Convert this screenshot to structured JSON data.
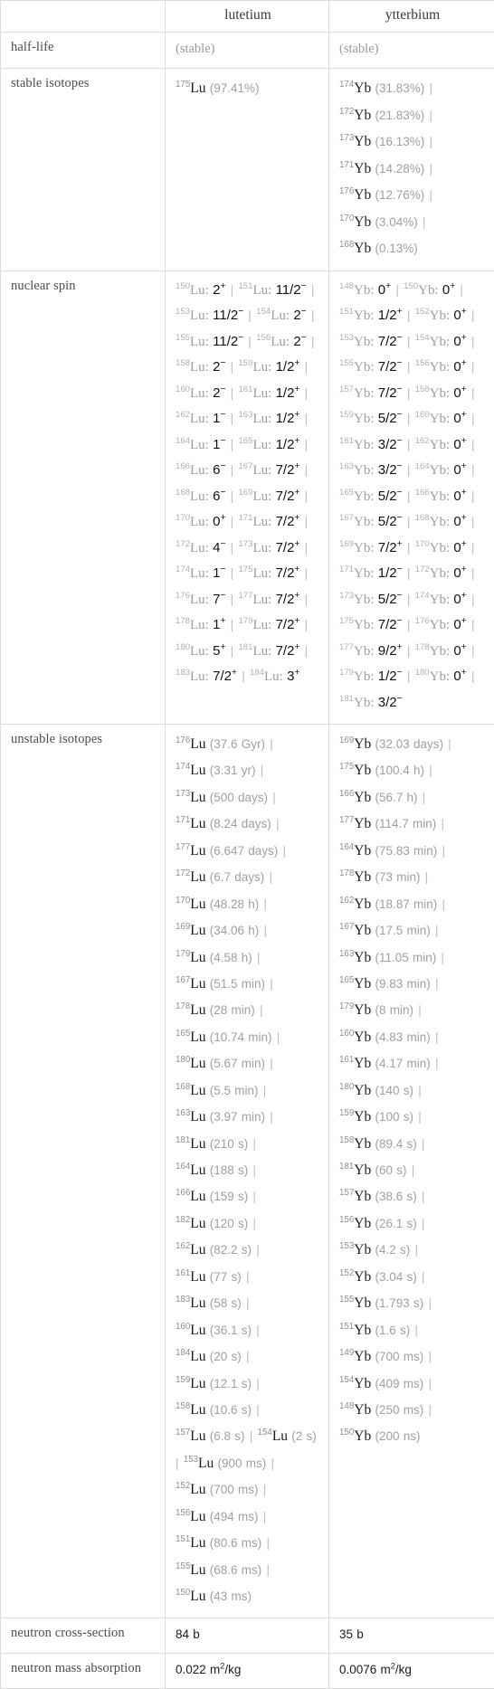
{
  "table": {
    "header": {
      "blank": "",
      "col1": "lutetium",
      "col2": "ytterbium"
    },
    "rows": [
      {
        "label": "half-life",
        "lutetium": {
          "kind": "muted_text",
          "text": "(stable)"
        },
        "ytterbium": {
          "kind": "muted_text",
          "text": "(stable)"
        }
      },
      {
        "label": "stable isotopes",
        "lutetium": {
          "kind": "isotope_list",
          "items": [
            {
              "mass": "175",
              "symbol": "Lu",
              "value": "(97.41%)"
            }
          ]
        },
        "ytterbium": {
          "kind": "isotope_list",
          "items": [
            {
              "mass": "174",
              "symbol": "Yb",
              "value": "(31.83%)"
            },
            {
              "mass": "172",
              "symbol": "Yb",
              "value": "(21.83%)"
            },
            {
              "mass": "173",
              "symbol": "Yb",
              "value": "(16.13%)"
            },
            {
              "mass": "171",
              "symbol": "Yb",
              "value": "(14.28%)"
            },
            {
              "mass": "176",
              "symbol": "Yb",
              "value": "(12.76%)"
            },
            {
              "mass": "170",
              "symbol": "Yb",
              "value": "(3.04%)"
            },
            {
              "mass": "168",
              "symbol": "Yb",
              "value": "(0.13%)"
            }
          ]
        }
      },
      {
        "label": "nuclear spin",
        "lutetium": {
          "kind": "spin_list",
          "items": [
            {
              "mass": "150",
              "symbol": "Lu",
              "spin": "2",
              "sign": "+"
            },
            {
              "mass": "151",
              "symbol": "Lu",
              "spin": "11/2",
              "sign": "−"
            },
            {
              "mass": "153",
              "symbol": "Lu",
              "spin": "11/2",
              "sign": "−"
            },
            {
              "mass": "154",
              "symbol": "Lu",
              "spin": "2",
              "sign": "−"
            },
            {
              "mass": "155",
              "symbol": "Lu",
              "spin": "11/2",
              "sign": "−"
            },
            {
              "mass": "156",
              "symbol": "Lu",
              "spin": "2",
              "sign": "−"
            },
            {
              "mass": "158",
              "symbol": "Lu",
              "spin": "2",
              "sign": "−"
            },
            {
              "mass": "159",
              "symbol": "Lu",
              "spin": "1/2",
              "sign": "+"
            },
            {
              "mass": "160",
              "symbol": "Lu",
              "spin": "2",
              "sign": "−"
            },
            {
              "mass": "161",
              "symbol": "Lu",
              "spin": "1/2",
              "sign": "+"
            },
            {
              "mass": "162",
              "symbol": "Lu",
              "spin": "1",
              "sign": "−"
            },
            {
              "mass": "163",
              "symbol": "Lu",
              "spin": "1/2",
              "sign": "+"
            },
            {
              "mass": "164",
              "symbol": "Lu",
              "spin": "1",
              "sign": "−"
            },
            {
              "mass": "165",
              "symbol": "Lu",
              "spin": "1/2",
              "sign": "+"
            },
            {
              "mass": "166",
              "symbol": "Lu",
              "spin": "6",
              "sign": "−"
            },
            {
              "mass": "167",
              "symbol": "Lu",
              "spin": "7/2",
              "sign": "+"
            },
            {
              "mass": "168",
              "symbol": "Lu",
              "spin": "6",
              "sign": "−"
            },
            {
              "mass": "169",
              "symbol": "Lu",
              "spin": "7/2",
              "sign": "+"
            },
            {
              "mass": "170",
              "symbol": "Lu",
              "spin": "0",
              "sign": "+"
            },
            {
              "mass": "171",
              "symbol": "Lu",
              "spin": "7/2",
              "sign": "+"
            },
            {
              "mass": "172",
              "symbol": "Lu",
              "spin": "4",
              "sign": "−"
            },
            {
              "mass": "173",
              "symbol": "Lu",
              "spin": "7/2",
              "sign": "+"
            },
            {
              "mass": "174",
              "symbol": "Lu",
              "spin": "1",
              "sign": "−"
            },
            {
              "mass": "175",
              "symbol": "Lu",
              "spin": "7/2",
              "sign": "+"
            },
            {
              "mass": "176",
              "symbol": "Lu",
              "spin": "7",
              "sign": "−"
            },
            {
              "mass": "177",
              "symbol": "Lu",
              "spin": "7/2",
              "sign": "+"
            },
            {
              "mass": "178",
              "symbol": "Lu",
              "spin": "1",
              "sign": "+"
            },
            {
              "mass": "179",
              "symbol": "Lu",
              "spin": "7/2",
              "sign": "+"
            },
            {
              "mass": "180",
              "symbol": "Lu",
              "spin": "5",
              "sign": "+"
            },
            {
              "mass": "181",
              "symbol": "Lu",
              "spin": "7/2",
              "sign": "+"
            },
            {
              "mass": "183",
              "symbol": "Lu",
              "spin": "7/2",
              "sign": "+"
            },
            {
              "mass": "184",
              "symbol": "Lu",
              "spin": "3",
              "sign": "+"
            }
          ]
        },
        "ytterbium": {
          "kind": "spin_list",
          "items": [
            {
              "mass": "148",
              "symbol": "Yb",
              "spin": "0",
              "sign": "+"
            },
            {
              "mass": "150",
              "symbol": "Yb",
              "spin": "0",
              "sign": "+"
            },
            {
              "mass": "151",
              "symbol": "Yb",
              "spin": "1/2",
              "sign": "+"
            },
            {
              "mass": "152",
              "symbol": "Yb",
              "spin": "0",
              "sign": "+"
            },
            {
              "mass": "153",
              "symbol": "Yb",
              "spin": "7/2",
              "sign": "−"
            },
            {
              "mass": "154",
              "symbol": "Yb",
              "spin": "0",
              "sign": "+"
            },
            {
              "mass": "155",
              "symbol": "Yb",
              "spin": "7/2",
              "sign": "−"
            },
            {
              "mass": "156",
              "symbol": "Yb",
              "spin": "0",
              "sign": "+"
            },
            {
              "mass": "157",
              "symbol": "Yb",
              "spin": "7/2",
              "sign": "−"
            },
            {
              "mass": "158",
              "symbol": "Yb",
              "spin": "0",
              "sign": "+"
            },
            {
              "mass": "159",
              "symbol": "Yb",
              "spin": "5/2",
              "sign": "−"
            },
            {
              "mass": "160",
              "symbol": "Yb",
              "spin": "0",
              "sign": "+"
            },
            {
              "mass": "161",
              "symbol": "Yb",
              "spin": "3/2",
              "sign": "−"
            },
            {
              "mass": "162",
              "symbol": "Yb",
              "spin": "0",
              "sign": "+"
            },
            {
              "mass": "163",
              "symbol": "Yb",
              "spin": "3/2",
              "sign": "−"
            },
            {
              "mass": "164",
              "symbol": "Yb",
              "spin": "0",
              "sign": "+"
            },
            {
              "mass": "165",
              "symbol": "Yb",
              "spin": "5/2",
              "sign": "−"
            },
            {
              "mass": "166",
              "symbol": "Yb",
              "spin": "0",
              "sign": "+"
            },
            {
              "mass": "167",
              "symbol": "Yb",
              "spin": "5/2",
              "sign": "−"
            },
            {
              "mass": "168",
              "symbol": "Yb",
              "spin": "0",
              "sign": "+"
            },
            {
              "mass": "169",
              "symbol": "Yb",
              "spin": "7/2",
              "sign": "+"
            },
            {
              "mass": "170",
              "symbol": "Yb",
              "spin": "0",
              "sign": "+"
            },
            {
              "mass": "171",
              "symbol": "Yb",
              "spin": "1/2",
              "sign": "−"
            },
            {
              "mass": "172",
              "symbol": "Yb",
              "spin": "0",
              "sign": "+"
            },
            {
              "mass": "173",
              "symbol": "Yb",
              "spin": "5/2",
              "sign": "−"
            },
            {
              "mass": "174",
              "symbol": "Yb",
              "spin": "0",
              "sign": "+"
            },
            {
              "mass": "175",
              "symbol": "Yb",
              "spin": "7/2",
              "sign": "−"
            },
            {
              "mass": "176",
              "symbol": "Yb",
              "spin": "0",
              "sign": "+"
            },
            {
              "mass": "177",
              "symbol": "Yb",
              "spin": "9/2",
              "sign": "+"
            },
            {
              "mass": "178",
              "symbol": "Yb",
              "spin": "0",
              "sign": "+"
            },
            {
              "mass": "179",
              "symbol": "Yb",
              "spin": "1/2",
              "sign": "−"
            },
            {
              "mass": "180",
              "symbol": "Yb",
              "spin": "0",
              "sign": "+"
            },
            {
              "mass": "181",
              "symbol": "Yb",
              "spin": "3/2",
              "sign": "−"
            }
          ]
        }
      },
      {
        "label": "unstable isotopes",
        "lutetium": {
          "kind": "isotope_list",
          "items": [
            {
              "mass": "176",
              "symbol": "Lu",
              "value": "(37.6 Gyr)"
            },
            {
              "mass": "174",
              "symbol": "Lu",
              "value": "(3.31 yr)"
            },
            {
              "mass": "173",
              "symbol": "Lu",
              "value": "(500 days)"
            },
            {
              "mass": "171",
              "symbol": "Lu",
              "value": "(8.24 days)"
            },
            {
              "mass": "177",
              "symbol": "Lu",
              "value": "(6.647 days)"
            },
            {
              "mass": "172",
              "symbol": "Lu",
              "value": "(6.7 days)"
            },
            {
              "mass": "170",
              "symbol": "Lu",
              "value": "(48.28 h)"
            },
            {
              "mass": "169",
              "symbol": "Lu",
              "value": "(34.06 h)"
            },
            {
              "mass": "179",
              "symbol": "Lu",
              "value": "(4.58 h)"
            },
            {
              "mass": "167",
              "symbol": "Lu",
              "value": "(51.5 min)"
            },
            {
              "mass": "178",
              "symbol": "Lu",
              "value": "(28 min)"
            },
            {
              "mass": "165",
              "symbol": "Lu",
              "value": "(10.74 min)"
            },
            {
              "mass": "180",
              "symbol": "Lu",
              "value": "(5.67 min)"
            },
            {
              "mass": "168",
              "symbol": "Lu",
              "value": "(5.5 min)"
            },
            {
              "mass": "163",
              "symbol": "Lu",
              "value": "(3.97 min)"
            },
            {
              "mass": "181",
              "symbol": "Lu",
              "value": "(210 s)"
            },
            {
              "mass": "164",
              "symbol": "Lu",
              "value": "(188 s)"
            },
            {
              "mass": "166",
              "symbol": "Lu",
              "value": "(159 s)"
            },
            {
              "mass": "182",
              "symbol": "Lu",
              "value": "(120 s)"
            },
            {
              "mass": "162",
              "symbol": "Lu",
              "value": "(82.2 s)"
            },
            {
              "mass": "161",
              "symbol": "Lu",
              "value": "(77 s)"
            },
            {
              "mass": "183",
              "symbol": "Lu",
              "value": "(58 s)"
            },
            {
              "mass": "160",
              "symbol": "Lu",
              "value": "(36.1 s)"
            },
            {
              "mass": "184",
              "symbol": "Lu",
              "value": "(20 s)"
            },
            {
              "mass": "159",
              "symbol": "Lu",
              "value": "(12.1 s)"
            },
            {
              "mass": "158",
              "symbol": "Lu",
              "value": "(10.6 s)"
            },
            {
              "mass": "157",
              "symbol": "Lu",
              "value": "(6.8 s)"
            },
            {
              "mass": "154",
              "symbol": "Lu",
              "value": "(2 s)"
            },
            {
              "mass": "153",
              "symbol": "Lu",
              "value": "(900 ms)"
            },
            {
              "mass": "152",
              "symbol": "Lu",
              "value": "(700 ms)"
            },
            {
              "mass": "156",
              "symbol": "Lu",
              "value": "(494 ms)"
            },
            {
              "mass": "151",
              "symbol": "Lu",
              "value": "(80.6 ms)"
            },
            {
              "mass": "155",
              "symbol": "Lu",
              "value": "(68.6 ms)"
            },
            {
              "mass": "150",
              "symbol": "Lu",
              "value": "(43 ms)"
            }
          ]
        },
        "ytterbium": {
          "kind": "isotope_list",
          "items": [
            {
              "mass": "169",
              "symbol": "Yb",
              "value": "(32.03 days)"
            },
            {
              "mass": "175",
              "symbol": "Yb",
              "value": "(100.4 h)"
            },
            {
              "mass": "166",
              "symbol": "Yb",
              "value": "(56.7 h)"
            },
            {
              "mass": "177",
              "symbol": "Yb",
              "value": "(114.7 min)"
            },
            {
              "mass": "164",
              "symbol": "Yb",
              "value": "(75.83 min)"
            },
            {
              "mass": "178",
              "symbol": "Yb",
              "value": "(73 min)"
            },
            {
              "mass": "162",
              "symbol": "Yb",
              "value": "(18.87 min)"
            },
            {
              "mass": "167",
              "symbol": "Yb",
              "value": "(17.5 min)"
            },
            {
              "mass": "163",
              "symbol": "Yb",
              "value": "(11.05 min)"
            },
            {
              "mass": "165",
              "symbol": "Yb",
              "value": "(9.83 min)"
            },
            {
              "mass": "179",
              "symbol": "Yb",
              "value": "(8 min)"
            },
            {
              "mass": "160",
              "symbol": "Yb",
              "value": "(4.83 min)"
            },
            {
              "mass": "161",
              "symbol": "Yb",
              "value": "(4.17 min)"
            },
            {
              "mass": "180",
              "symbol": "Yb",
              "value": "(140 s)"
            },
            {
              "mass": "159",
              "symbol": "Yb",
              "value": "(100 s)"
            },
            {
              "mass": "158",
              "symbol": "Yb",
              "value": "(89.4 s)"
            },
            {
              "mass": "181",
              "symbol": "Yb",
              "value": "(60 s)"
            },
            {
              "mass": "157",
              "symbol": "Yb",
              "value": "(38.6 s)"
            },
            {
              "mass": "156",
              "symbol": "Yb",
              "value": "(26.1 s)"
            },
            {
              "mass": "153",
              "symbol": "Yb",
              "value": "(4.2 s)"
            },
            {
              "mass": "152",
              "symbol": "Yb",
              "value": "(3.04 s)"
            },
            {
              "mass": "155",
              "symbol": "Yb",
              "value": "(1.793 s)"
            },
            {
              "mass": "151",
              "symbol": "Yb",
              "value": "(1.6 s)"
            },
            {
              "mass": "149",
              "symbol": "Yb",
              "value": "(700 ms)"
            },
            {
              "mass": "154",
              "symbol": "Yb",
              "value": "(409 ms)"
            },
            {
              "mass": "148",
              "symbol": "Yb",
              "value": "(250 ms)"
            },
            {
              "mass": "150",
              "symbol": "Yb",
              "value": "(200 ns)"
            }
          ]
        }
      },
      {
        "label": "neutron cross-section",
        "lutetium": {
          "kind": "plain",
          "text": "84 b"
        },
        "ytterbium": {
          "kind": "plain",
          "text": "35 b"
        }
      },
      {
        "label": "neutron mass absorption",
        "lutetium": {
          "kind": "unit_sup",
          "pre": "0.022 m",
          "sup": "2",
          "post": "/kg"
        },
        "ytterbium": {
          "kind": "unit_sup",
          "pre": "0.0076 m",
          "sup": "2",
          "post": "/kg"
        }
      }
    ]
  },
  "colors": {
    "border": "#dcdcdc",
    "label_text": "#4d4d4d",
    "value_text": "#1b1b1b",
    "muted_text": "#a0a0a0",
    "superscript_text": "#9d9d9d",
    "separator": "#bdbdbd",
    "background": "#ffffff"
  }
}
